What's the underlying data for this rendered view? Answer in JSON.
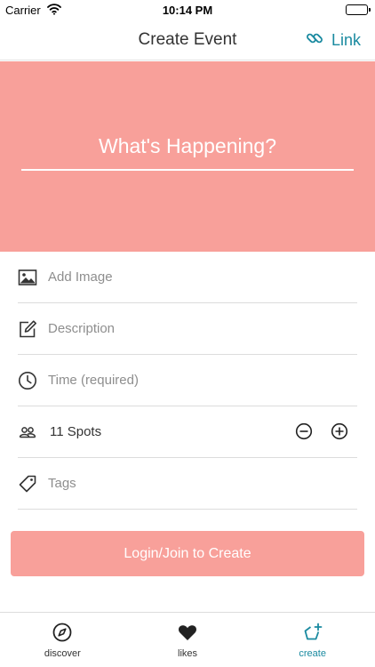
{
  "status_bar": {
    "carrier": "Carrier",
    "time": "10:14 PM"
  },
  "nav": {
    "title": "Create Event",
    "link_label": "Link",
    "link_icon": "link-icon"
  },
  "hero": {
    "placeholder": "What's Happening?",
    "background": "#f8a09a"
  },
  "form": {
    "image": {
      "icon": "image-icon",
      "placeholder": "Add Image"
    },
    "description": {
      "icon": "edit-icon",
      "placeholder": "Description"
    },
    "time": {
      "icon": "clock-icon",
      "placeholder": "Time (required)"
    },
    "spots": {
      "icon": "people-icon",
      "value": "11 Spots",
      "decrement_icon": "minus-circle-icon",
      "increment_icon": "plus-circle-icon"
    },
    "tags": {
      "icon": "tag-icon",
      "placeholder": "Tags"
    }
  },
  "cta": {
    "label": "Login/Join to Create",
    "color": "#f8a09a"
  },
  "tabs": [
    {
      "label": "discover",
      "icon": "compass-icon",
      "active": false
    },
    {
      "label": "likes",
      "icon": "heart-icon",
      "active": false
    },
    {
      "label": "create",
      "icon": "create-icon",
      "active": true
    }
  ],
  "colors": {
    "accent": "#1a8aa0",
    "brand": "#f8a09a"
  }
}
